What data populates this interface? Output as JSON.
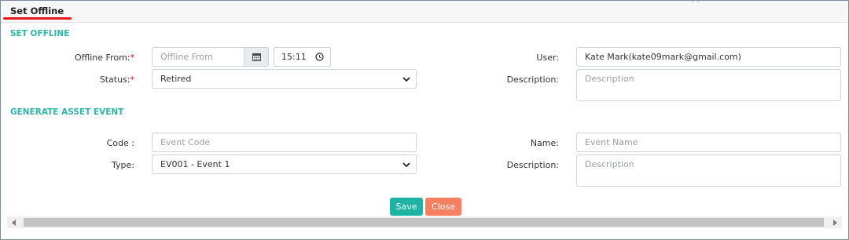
{
  "header": {
    "title": "Set Offline",
    "accent_color": "#e8171f",
    "dots": "· ·"
  },
  "set_offline": {
    "section_title": "SET OFFLINE",
    "offline_from_label": "Offline From:",
    "offline_from_placeholder": "Offline From",
    "offline_from_time": "15:11",
    "status_label": "Status:",
    "status_value": "Retired",
    "user_label": "User:",
    "user_value": "Kate Mark(kate09mark@gmail.com)",
    "description_label": "Description:",
    "description_placeholder": "Description",
    "required_mark": "*"
  },
  "asset_event": {
    "section_title": "GENERATE ASSET EVENT",
    "code_label": "Code :",
    "code_placeholder": "Event Code",
    "type_label": "Type:",
    "type_value": "EV001 - Event 1",
    "name_label": "Name:",
    "name_placeholder": "Event Name",
    "description_label": "Description:",
    "description_placeholder": "Description"
  },
  "actions": {
    "save_label": "Save",
    "close_label": "Close",
    "save_color": "#1fb3a5",
    "close_color": "#f78060"
  },
  "icons": {
    "calendar": "calendar-icon",
    "clock": "clock-icon",
    "chevron": "chevron-down-icon"
  }
}
